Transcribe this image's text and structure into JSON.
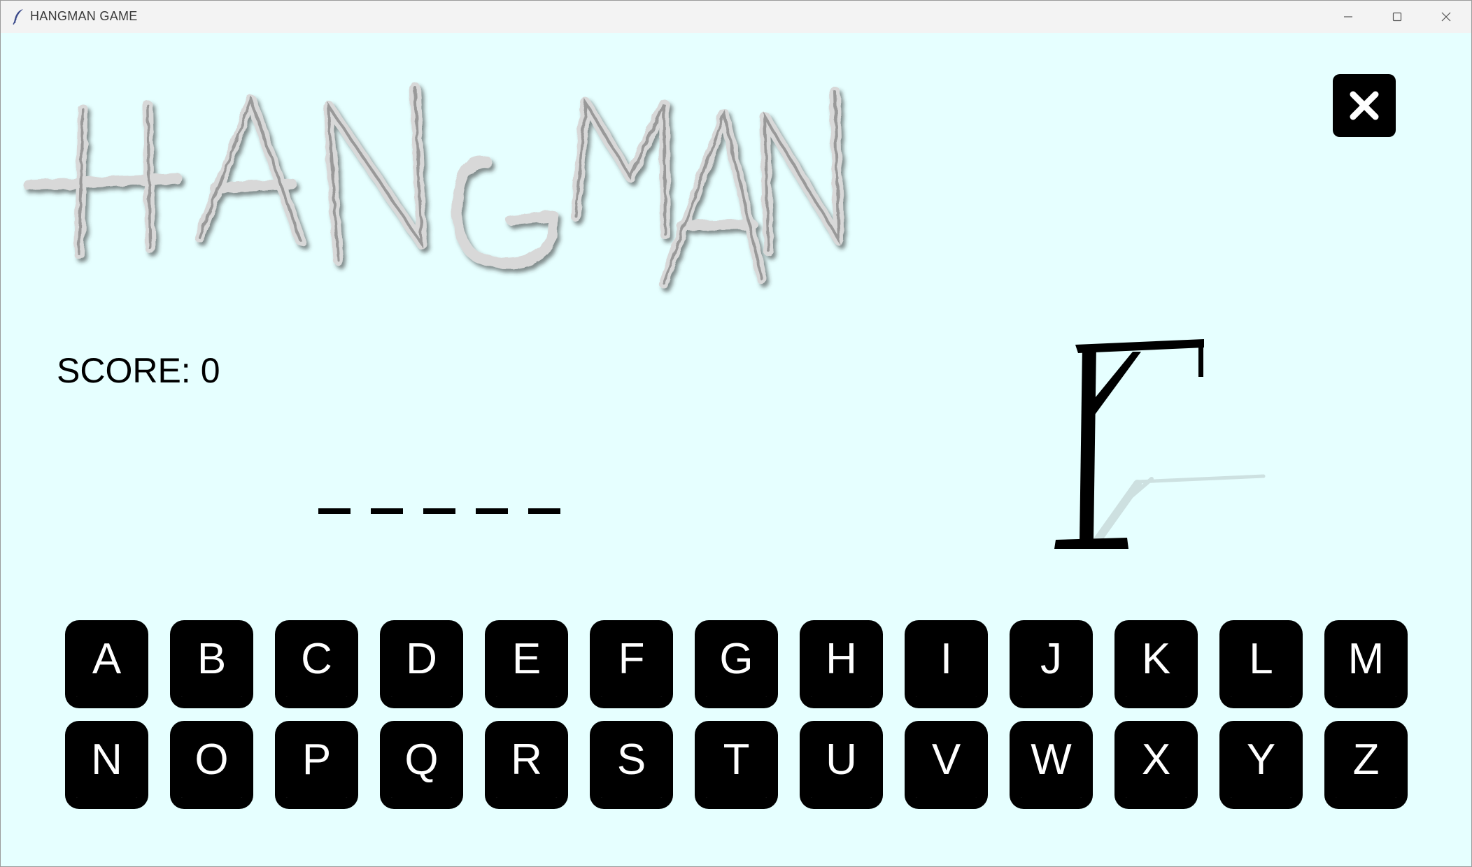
{
  "window": {
    "title": "HANGMAN GAME"
  },
  "header": {
    "logo_text": "HANGMAN"
  },
  "score": {
    "label": "SCORE:",
    "value": "0"
  },
  "word": {
    "letters": [
      "",
      "",
      "",
      "",
      ""
    ]
  },
  "keyboard": {
    "row1": [
      "A",
      "B",
      "C",
      "D",
      "E",
      "F",
      "G",
      "H",
      "I",
      "J",
      "K",
      "L",
      "M"
    ],
    "row2": [
      "N",
      "O",
      "P",
      "Q",
      "R",
      "S",
      "T",
      "U",
      "V",
      "W",
      "X",
      "Y",
      "Z"
    ]
  },
  "icons": {
    "app": "feather-icon",
    "minimize": "minimize-icon",
    "maximize": "maximize-icon",
    "close": "close-icon",
    "exit": "x-icon",
    "gallows": "gallows-icon"
  },
  "colors": {
    "background": "#e6ffff",
    "key": "#000000",
    "key_text": "#ffffff",
    "text": "#000000"
  }
}
